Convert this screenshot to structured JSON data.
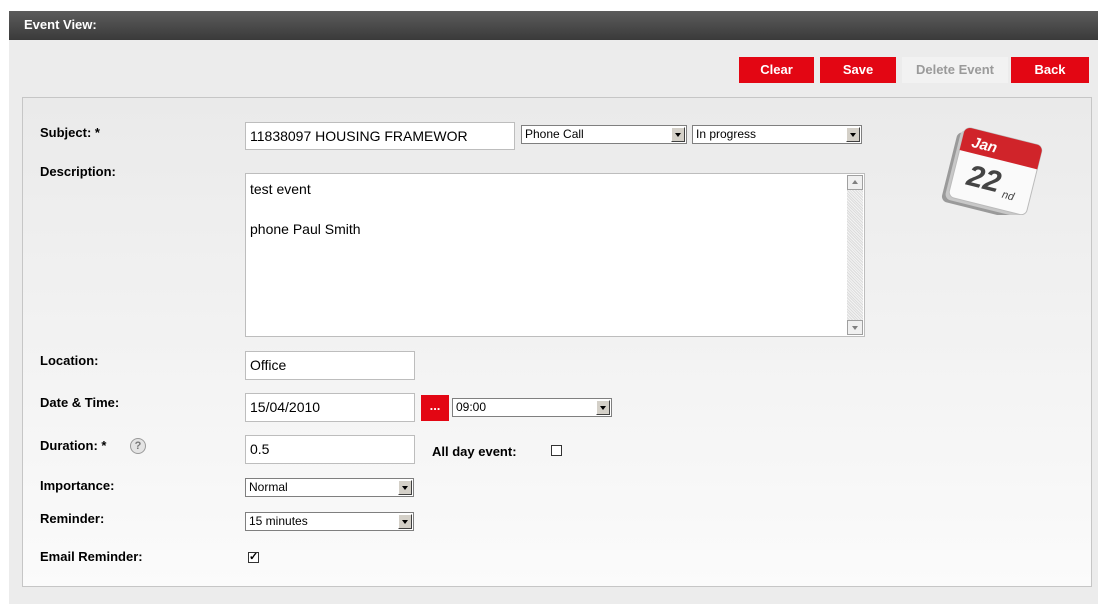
{
  "window": {
    "title": "Event View:"
  },
  "toolbar": {
    "clear": "Clear",
    "save": "Save",
    "delete": "Delete Event",
    "back": "Back"
  },
  "form": {
    "subject": {
      "label": "Subject: *",
      "value": "11838097 HOUSING FRAMEWOR",
      "type": "Phone Call",
      "status": "In progress"
    },
    "description": {
      "label": "Description:",
      "value": "test event\n\nphone Paul Smith"
    },
    "location": {
      "label": "Location:",
      "value": "Office"
    },
    "datetime": {
      "label": "Date & Time:",
      "date": "15/04/2010",
      "picker": "...",
      "time": "09:00"
    },
    "duration": {
      "label": "Duration: *",
      "value": "0.5",
      "help": "?",
      "all_day_label": "All day event:",
      "all_day": false
    },
    "importance": {
      "label": "Importance:",
      "value": "Normal"
    },
    "reminder": {
      "label": "Reminder:",
      "value": "15 minutes"
    },
    "email_reminder": {
      "label": "Email Reminder:",
      "checked": true
    }
  },
  "calendar_icon": {
    "month": "Jan",
    "day": "22",
    "suffix": "nd"
  },
  "icons": [
    "calendar-icon",
    "help-icon",
    "dropdown-arrow-icon",
    "checkbox-checkmark-icon"
  ],
  "colors": {
    "accent": "#e30613",
    "titlebar": "#4a4a4a"
  }
}
